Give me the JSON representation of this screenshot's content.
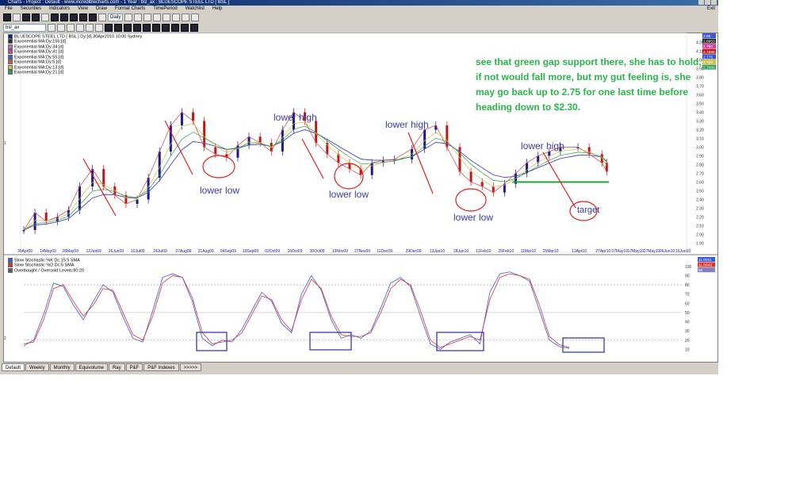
{
  "window": {
    "title": "Charts - Project : Default - www.incrediblecharts.com - 1 Year : bsl_ax : BLUESCOPE STEEL LTD [ BSL ]"
  },
  "menu": [
    "File",
    "Securities",
    "Indicators",
    "View",
    "Draw",
    "Format Charts",
    "TimePeriod",
    "Watchlist",
    "Help"
  ],
  "menu_right": "Exit",
  "toolbar": {
    "period": "Daily",
    "symbol": "bsl_ax"
  },
  "tabs": [
    "Default",
    "Weekly",
    "Monthly",
    "Equivolume",
    "Ray",
    "P&F",
    "P&F Indexes",
    ">>>>>"
  ],
  "price_legend": [
    {
      "label": "BLUESCOPE STEEL LTD [ BSL ] Dy:[d] 30Apr2010 10:00 Sydney",
      "color": "#1a1a8c"
    },
    {
      "label": "Exponential MA:Dy:155:[d]",
      "color": "#303030"
    },
    {
      "label": "Exponential MA:Dy:34:[d]",
      "color": "#b36bd6"
    },
    {
      "label": "Exponential MA:Dy:41:[d]",
      "color": "#d23c9c"
    },
    {
      "label": "Exponential MA:Dy:55:[d]",
      "color": "#3b5ad8"
    },
    {
      "label": "Exponential MA:Dy:5:[d]",
      "color": "#e05050"
    },
    {
      "label": "Exponential MA:Dy:13:[d]",
      "color": "#d4c23c"
    },
    {
      "label": "Exponential MA:Dy:21:[d]",
      "color": "#28a050"
    }
  ],
  "stoch_legend": [
    {
      "label": "Slow Stochastic %K Dc:15:5 SMA",
      "color": "#3b5ad8"
    },
    {
      "label": "Slow Stochastic %D Dc:5 SMA",
      "color": "#e03030"
    },
    {
      "label": "Overbought / Oversold Levels:80:20",
      "color": "#606060"
    }
  ],
  "price_badges": [
    {
      "text": "2.85",
      "color": "#3b5ad8"
    },
    {
      "text": "2.8953",
      "color": "#202020"
    },
    {
      "text": "2.790",
      "color": "#d23c9c"
    },
    {
      "text": "2.7888",
      "color": "#c01818"
    },
    {
      "text": "2.776",
      "color": "#3050d0"
    },
    {
      "text": "2.720",
      "color": "#d4c23c"
    },
    {
      "text": "2.7066",
      "color": "#28a050"
    }
  ],
  "stoch_badges": [
    {
      "text": "11.0011",
      "color": "#3b5ad8"
    },
    {
      "text": "11.8643",
      "color": "#e03030"
    },
    {
      "text": "80",
      "color": "#8080c0"
    }
  ],
  "pane_labels": {
    "price": "1",
    "stoch": "2"
  },
  "annotation": {
    "comment": "see that green gap support there, she has to hold, if not would fall more, but my gut feeling is, she may go back up to 2.75 for one last time before heading down to $2.30.",
    "labels": [
      "lower low",
      "lower high",
      "lower low",
      "lower high",
      "lower low",
      "lower high",
      "target"
    ]
  },
  "chart_data": [
    {
      "type": "candlestick",
      "title": "BLUESCOPE STEEL LTD [ BSL ]",
      "x_ticks": [
        "30Apr09",
        "14May09",
        "28May09",
        "12Jun09",
        "26Jun09",
        "10Jul09",
        "24Jul09",
        "07Aug09",
        "21Aug09",
        "04Sep09",
        "18Sep09",
        "02Oct09",
        "16Oct09",
        "30Oct09",
        "13Nov09",
        "27Nov09",
        "11Dec09",
        "29Dec09",
        "13Jan10",
        "28Jan10",
        "11Feb10",
        "25Feb10",
        "11Mar10",
        "25Mar10",
        "12Apr10",
        "27Apr10",
        "07May10",
        "17May10",
        "27May10",
        "06Jun10",
        "16Jun10"
      ],
      "y_ticks": [
        1.9,
        2.0,
        2.1,
        2.2,
        2.3,
        2.4,
        2.5,
        2.6,
        2.7,
        2.8,
        2.9,
        3.0,
        3.1,
        3.2,
        3.3,
        3.4,
        3.5,
        3.6,
        3.7,
        3.8,
        3.9,
        4.0,
        4.1,
        4.2
      ],
      "ylim": [
        1.85,
        4.25
      ],
      "close_approx": [
        [
          "30Apr09",
          2.05
        ],
        [
          "07May09",
          2.25
        ],
        [
          "14May09",
          2.15
        ],
        [
          "21May09",
          2.2
        ],
        [
          "28May09",
          2.28
        ],
        [
          "04Jun09",
          2.55
        ],
        [
          "12Jun09",
          2.75
        ],
        [
          "19Jun09",
          2.55
        ],
        [
          "26Jun09",
          2.45
        ],
        [
          "03Jul09",
          2.35
        ],
        [
          "10Jul09",
          2.4
        ],
        [
          "17Jul09",
          2.65
        ],
        [
          "24Jul09",
          2.95
        ],
        [
          "31Jul09",
          3.25
        ],
        [
          "07Aug09",
          3.4
        ],
        [
          "14Aug09",
          3.3
        ],
        [
          "21Aug09",
          3.0
        ],
        [
          "28Aug09",
          2.92
        ],
        [
          "04Sep09",
          2.88
        ],
        [
          "11Sep09",
          3.02
        ],
        [
          "18Sep09",
          3.12
        ],
        [
          "25Sep09",
          3.05
        ],
        [
          "02Oct09",
          2.95
        ],
        [
          "09Oct09",
          3.2
        ],
        [
          "16Oct09",
          3.4
        ],
        [
          "23Oct09",
          3.3
        ],
        [
          "30Oct09",
          3.05
        ],
        [
          "06Nov09",
          2.92
        ],
        [
          "13Nov09",
          2.82
        ],
        [
          "20Nov09",
          2.75
        ],
        [
          "27Nov09",
          2.68
        ],
        [
          "04Dec09",
          2.82
        ],
        [
          "11Dec09",
          2.85
        ],
        [
          "18Dec09",
          2.86
        ],
        [
          "29Dec09",
          2.98
        ],
        [
          "06Jan10",
          3.2
        ],
        [
          "13Jan10",
          3.25
        ],
        [
          "20Jan10",
          3.0
        ],
        [
          "28Jan10",
          2.72
        ],
        [
          "04Feb10",
          2.6
        ],
        [
          "11Feb10",
          2.55
        ],
        [
          "18Feb10",
          2.48
        ],
        [
          "25Feb10",
          2.58
        ],
        [
          "04Mar10",
          2.7
        ],
        [
          "11Mar10",
          2.82
        ],
        [
          "18Mar10",
          2.9
        ],
        [
          "25Mar10",
          2.95
        ],
        [
          "01Apr10",
          3.0
        ],
        [
          "12Apr10",
          3.0
        ],
        [
          "19Apr10",
          2.92
        ],
        [
          "27Apr10",
          2.82
        ],
        [
          "30Apr10",
          2.72
        ]
      ],
      "support_level": 2.6,
      "target_level": 2.3
    },
    {
      "type": "line",
      "title": "Slow Stochastic",
      "y_ticks": [
        10,
        20,
        30,
        40,
        50,
        60,
        70,
        80,
        90,
        100
      ],
      "ylim": [
        0,
        105
      ],
      "levels": [
        20,
        50,
        80
      ],
      "series": [
        {
          "name": "Slow Stochastic %K Dc:15:5 SMA",
          "values": [
            14,
            20,
            48,
            82,
            78,
            58,
            42,
            62,
            80,
            72,
            45,
            22,
            18,
            52,
            88,
            92,
            88,
            62,
            22,
            14,
            20,
            18,
            32,
            52,
            72,
            62,
            38,
            28,
            70,
            90,
            74,
            42,
            22,
            26,
            22,
            30,
            55,
            82,
            88,
            78,
            46,
            16,
            10,
            18,
            22,
            26,
            16,
            72,
            92,
            94,
            90,
            84,
            52,
            20,
            13,
            11
          ]
        },
        {
          "name": "Slow Stochastic %D Dc:5 SMA",
          "values": [
            16,
            18,
            42,
            76,
            80,
            62,
            46,
            58,
            76,
            74,
            50,
            26,
            20,
            46,
            82,
            90,
            88,
            66,
            28,
            16,
            18,
            20,
            28,
            48,
            68,
            64,
            42,
            30,
            64,
            86,
            76,
            46,
            26,
            24,
            24,
            28,
            50,
            76,
            86,
            80,
            52,
            20,
            12,
            16,
            20,
            24,
            20,
            64,
            88,
            92,
            90,
            86,
            58,
            24,
            15,
            12
          ]
        }
      ]
    }
  ]
}
